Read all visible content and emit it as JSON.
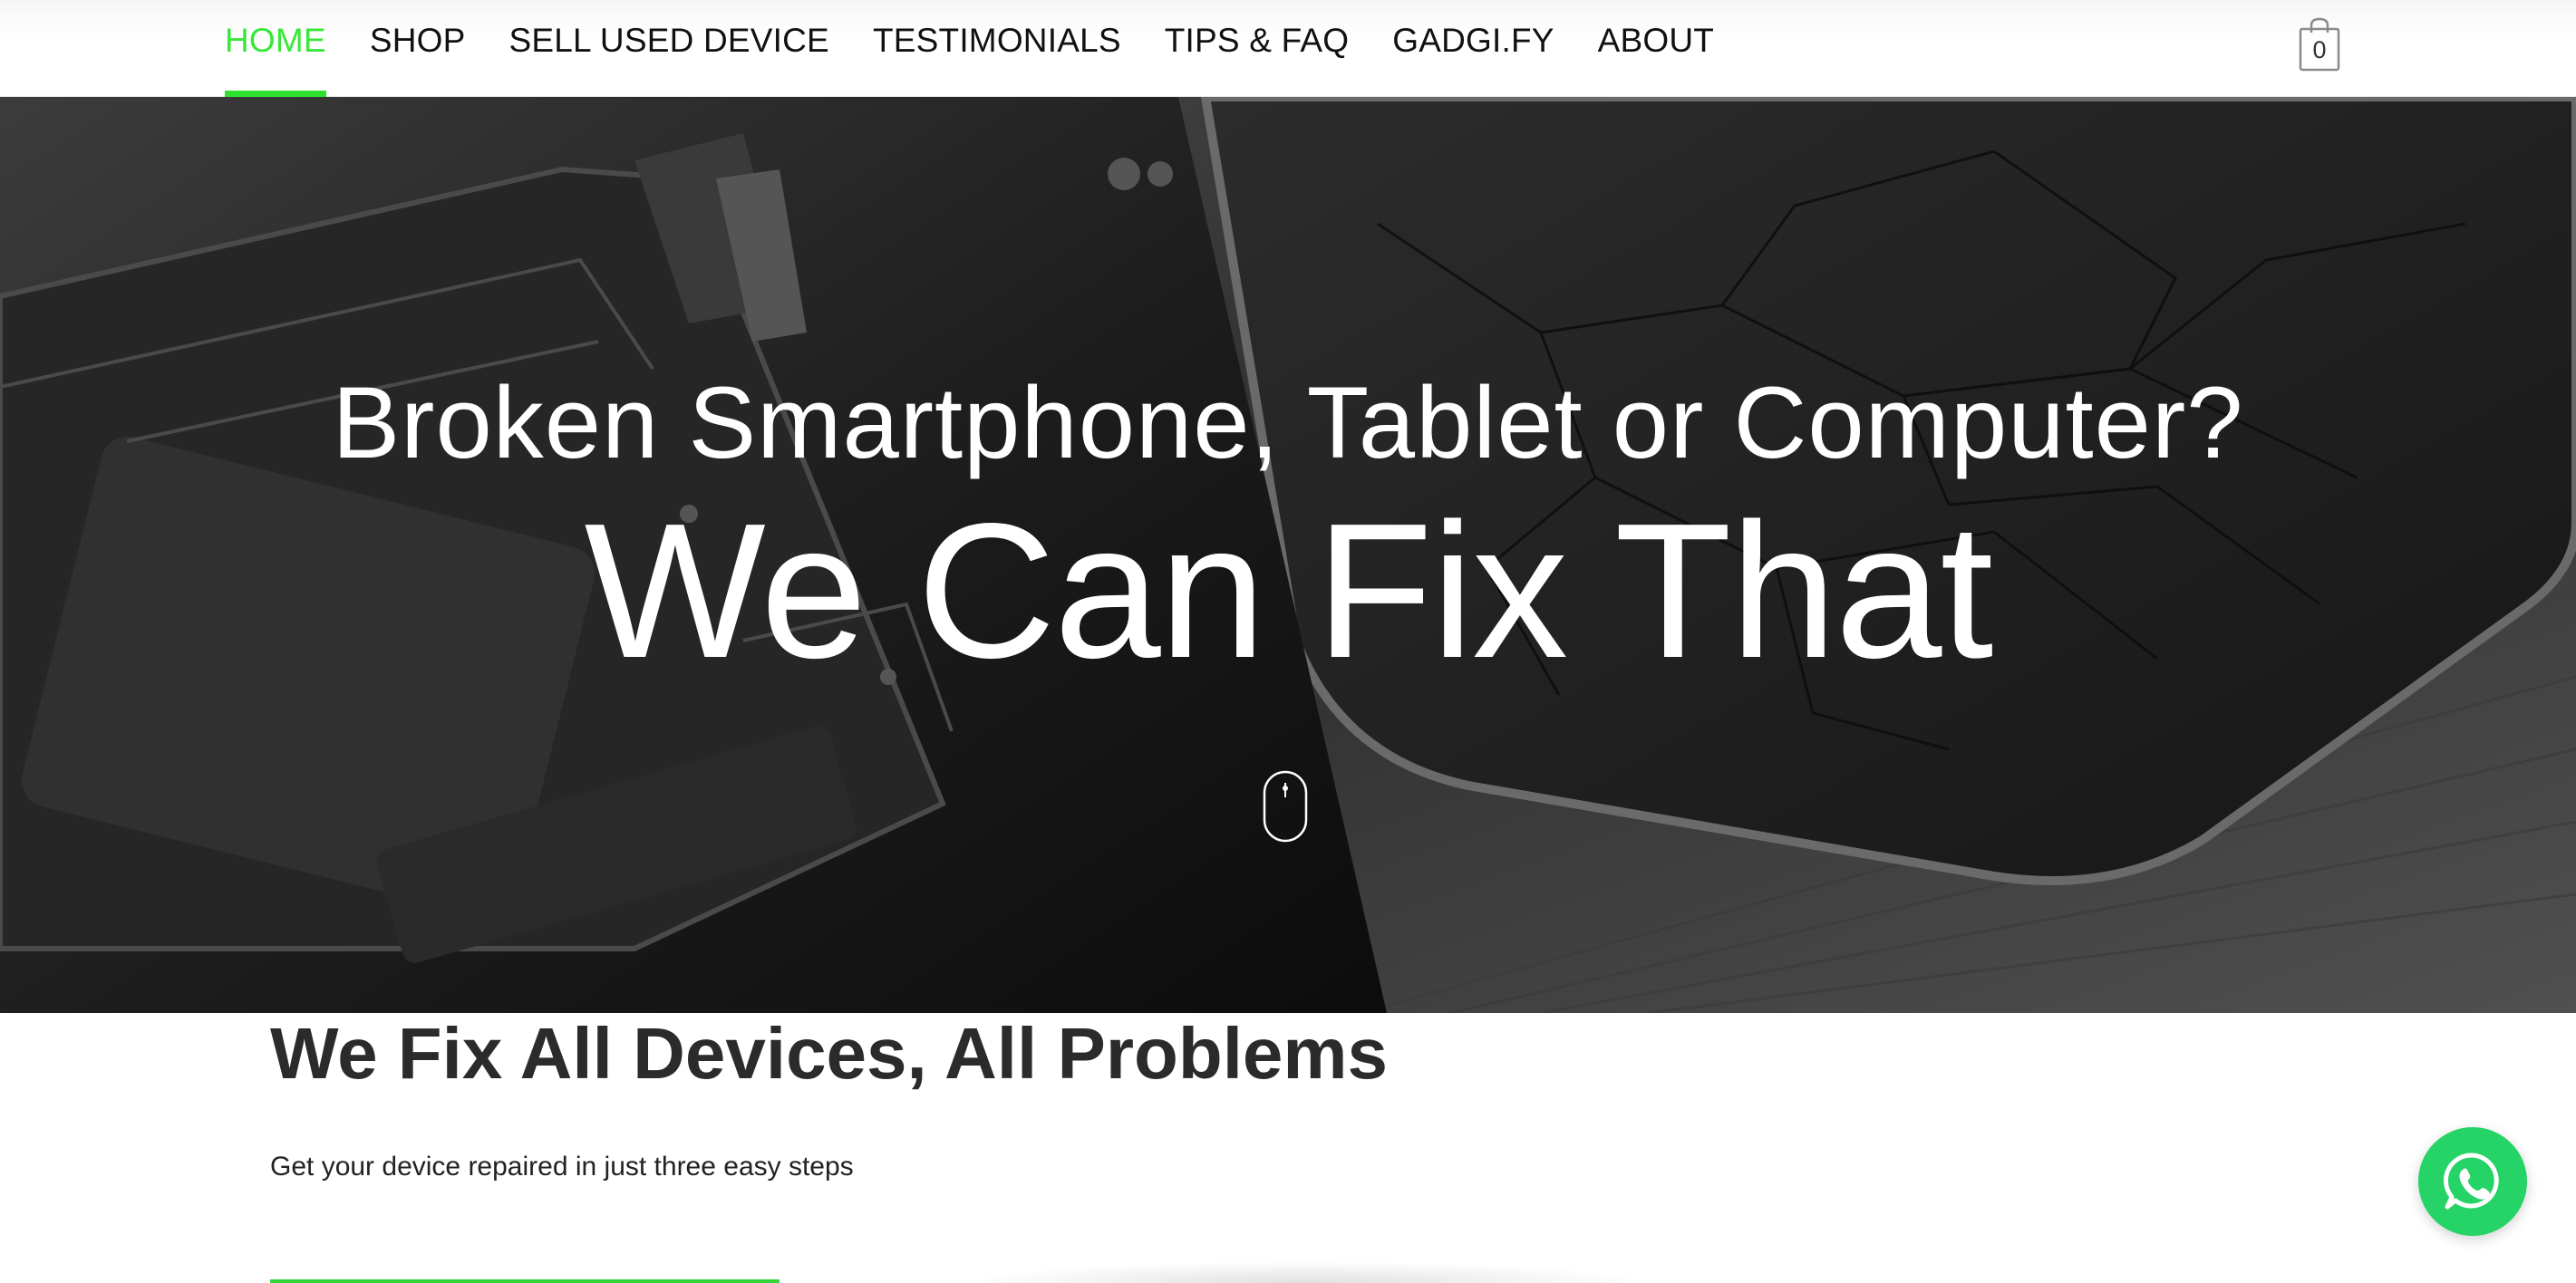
{
  "nav": {
    "items": [
      {
        "label": "HOME",
        "active": true
      },
      {
        "label": "SHOP",
        "active": false
      },
      {
        "label": "SELL USED DEVICE",
        "active": false
      },
      {
        "label": "TESTIMONIALS",
        "active": false
      },
      {
        "label": "TIPS & FAQ",
        "active": false
      },
      {
        "label": "GADGI.FY",
        "active": false
      },
      {
        "label": "ABOUT",
        "active": false
      }
    ],
    "active_color": "#39e639"
  },
  "cart": {
    "icon": "shopping-bag-icon",
    "count": "0"
  },
  "hero": {
    "line1": "Broken Smartphone, Tablet or Computer?",
    "line2": "We Can Fix That",
    "scroll_icon": "scroll-mouse-icon"
  },
  "section": {
    "title": "We Fix All Devices, All Problems",
    "subtitle": "Get your device repaired in just three easy steps"
  },
  "whatsapp": {
    "icon": "whatsapp-icon",
    "color": "#25d366"
  }
}
